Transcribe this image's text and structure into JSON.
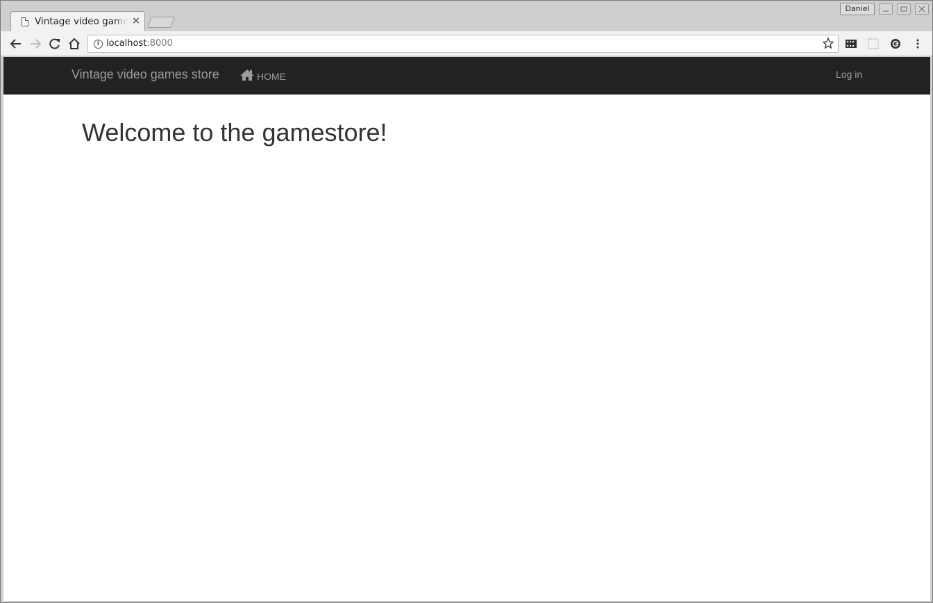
{
  "browser": {
    "tab": {
      "title": "Vintage video games store",
      "close_label": "×"
    },
    "profile_name": "Daniel",
    "address": {
      "host": "localhost",
      "port": ":8000"
    },
    "icons": {
      "back": "back-arrow-icon",
      "forward": "forward-arrow-icon",
      "reload": "reload-icon",
      "home": "home-icon",
      "info": "info-icon",
      "bookmark": "star-icon"
    }
  },
  "site": {
    "navbar": {
      "brand": "Vintage video games store",
      "home_label": "HOME",
      "login_label": "Log in",
      "background": "#222222",
      "link_color": "#9d9d9d"
    },
    "main": {
      "heading": "Welcome to the gamestore!"
    }
  }
}
